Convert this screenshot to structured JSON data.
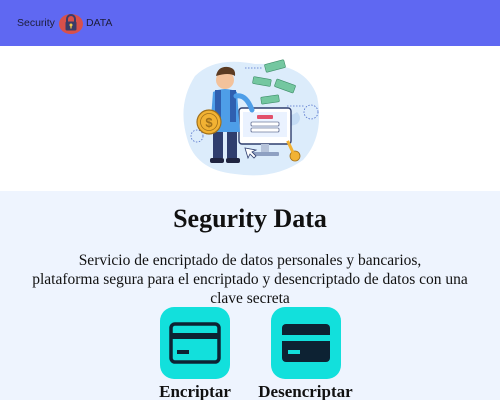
{
  "header": {
    "brand_left": "Security",
    "brand_right": "DATA",
    "bg_color": "#5f68f2"
  },
  "hero": {
    "illustration_icon": "man-with-dollar-coin-and-computer-login-illustration"
  },
  "main": {
    "title": "Segurity Data",
    "description_lines": [
      "Servicio de encriptado de datos personales y bancarios,",
      "plataforma segura para el encriptado y desencriptado de datos con una clave secreta"
    ],
    "actions": [
      {
        "label": "Encriptar",
        "icon": "credit-card-icon"
      },
      {
        "label": "Desencriptar",
        "icon": "credit-card-icon"
      }
    ],
    "accent_color": "#12e0dc"
  }
}
